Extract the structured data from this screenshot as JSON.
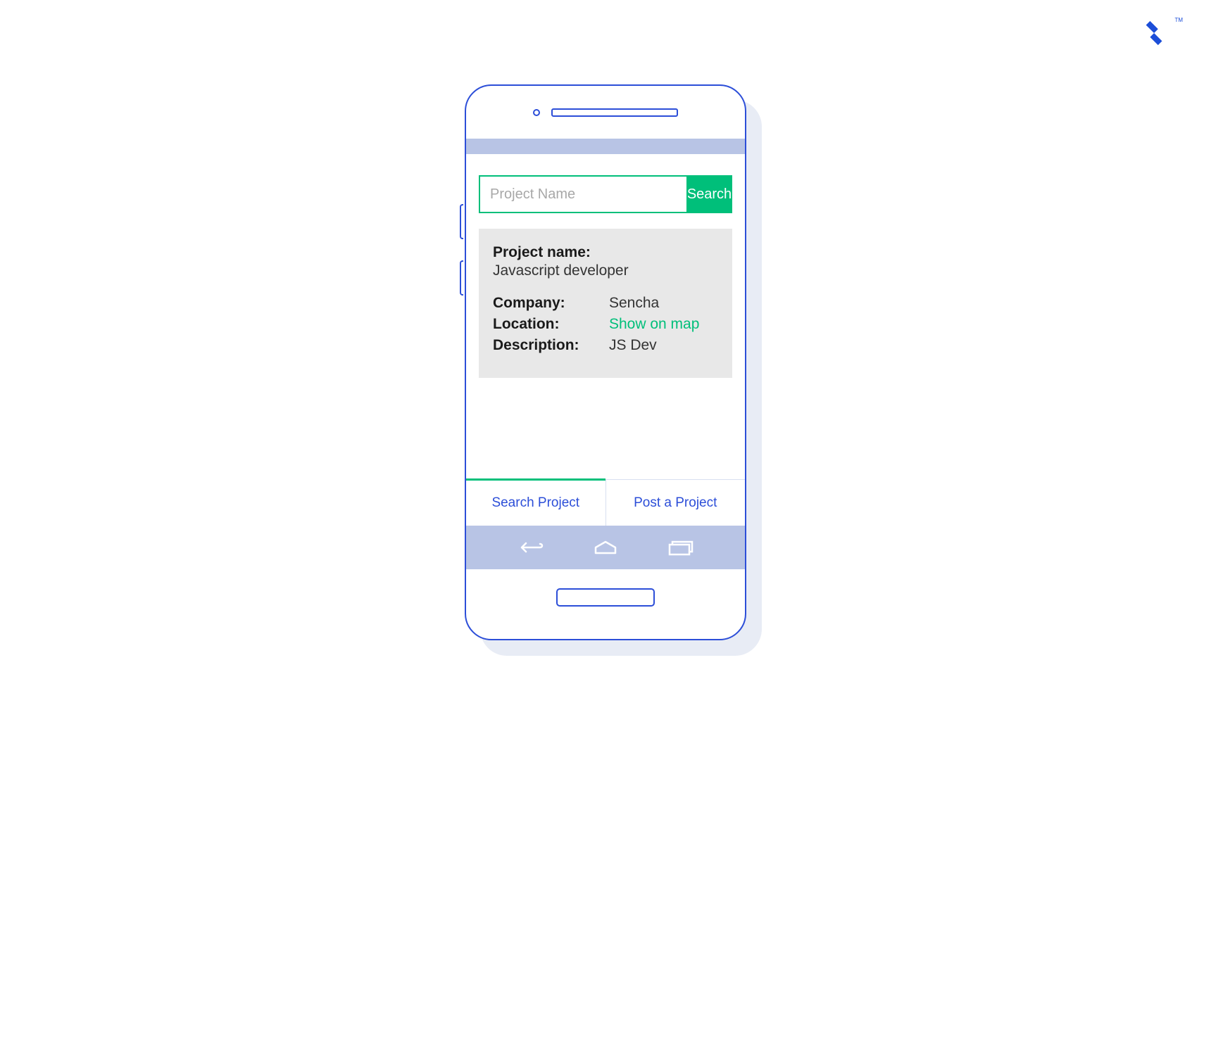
{
  "search": {
    "placeholder": "Project Name",
    "button_label": "Search"
  },
  "result": {
    "project_name_label": "Project name:",
    "project_name_value": "Javascript developer",
    "company_label": "Company:",
    "company_value": "Sencha",
    "location_label": "Location:",
    "location_link": "Show on map",
    "description_label": "Description:",
    "description_value": "JS Dev"
  },
  "tabs": {
    "search_project": "Search Project",
    "post_project": "Post a Project"
  }
}
